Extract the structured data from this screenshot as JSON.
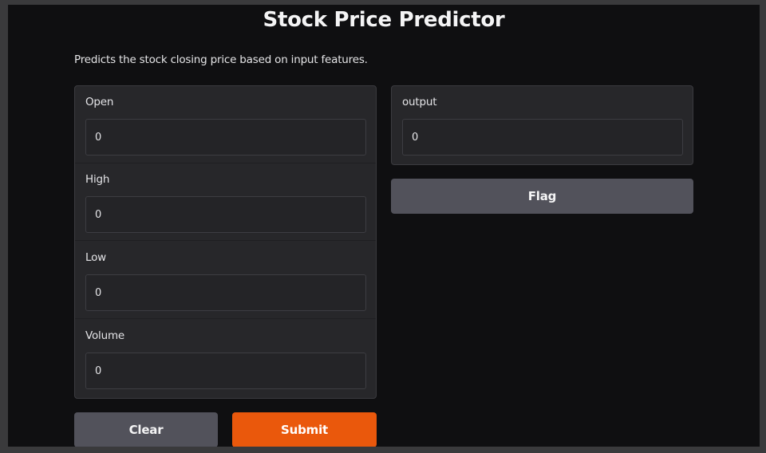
{
  "app": {
    "title": "Stock Price Predictor",
    "description": "Predicts the stock closing price based on input features."
  },
  "inputs": [
    {
      "label": "Open",
      "value": "0"
    },
    {
      "label": "High",
      "value": "0"
    },
    {
      "label": "Low",
      "value": "0"
    },
    {
      "label": "Volume",
      "value": "0"
    }
  ],
  "output": {
    "label": "output",
    "value": "0"
  },
  "buttons": {
    "clear_label": "Clear",
    "submit_label": "Submit",
    "flag_label": "Flag"
  },
  "colors": {
    "background": "#0f0f11",
    "panel": "#27272a",
    "secondary_button": "#52525b",
    "primary_button": "#ea580c"
  }
}
